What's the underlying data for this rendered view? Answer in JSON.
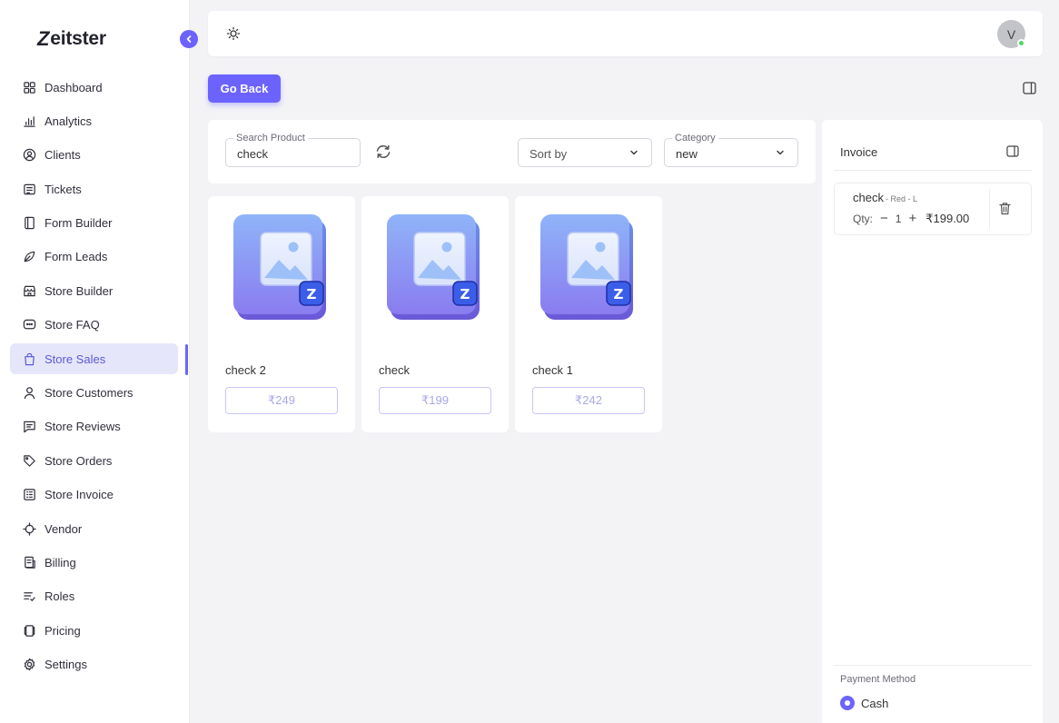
{
  "brand": {
    "name": "eitster",
    "mark": "Z"
  },
  "sidebar": {
    "items": [
      {
        "label": "Dashboard",
        "icon": "grid-icon"
      },
      {
        "label": "Analytics",
        "icon": "bar-chart-icon"
      },
      {
        "label": "Clients",
        "icon": "user-circle-icon"
      },
      {
        "label": "Tickets",
        "icon": "ticket-icon"
      },
      {
        "label": "Form Builder",
        "icon": "form-icon"
      },
      {
        "label": "Form Leads",
        "icon": "leaf-icon"
      },
      {
        "label": "Store Builder",
        "icon": "store-icon"
      },
      {
        "label": "Store FAQ",
        "icon": "chat-icon"
      },
      {
        "label": "Store Sales",
        "icon": "bag-icon"
      },
      {
        "label": "Store Customers",
        "icon": "user-icon"
      },
      {
        "label": "Store Reviews",
        "icon": "message-icon"
      },
      {
        "label": "Store Orders",
        "icon": "tag-icon"
      },
      {
        "label": "Store Invoice",
        "icon": "invoice-icon"
      },
      {
        "label": "Vendor",
        "icon": "vendor-icon"
      },
      {
        "label": "Billing",
        "icon": "billing-icon"
      },
      {
        "label": "Roles",
        "icon": "roles-icon"
      },
      {
        "label": "Pricing",
        "icon": "pricing-icon"
      },
      {
        "label": "Settings",
        "icon": "settings-icon"
      }
    ],
    "active": "Store Sales"
  },
  "topbar": {
    "avatar_initial": "V"
  },
  "actions": {
    "go_back": "Go Back"
  },
  "filters": {
    "search_label": "Search Product",
    "search_value": "check",
    "sort_placeholder": "Sort by",
    "category_label": "Category",
    "category_value": "new"
  },
  "products": [
    {
      "name": "check 2",
      "price": "₹249"
    },
    {
      "name": "check",
      "price": "₹199"
    },
    {
      "name": "check 1",
      "price": "₹242"
    }
  ],
  "invoice": {
    "title": "Invoice",
    "items": [
      {
        "name": "check",
        "variant": "- Red - L",
        "qty_label": "Qty:",
        "qty": "1",
        "price": "₹199.00"
      }
    ],
    "payment_label": "Payment Method",
    "payment_option": "Cash"
  },
  "colors": {
    "accent": "#6c63ff",
    "active_bg": "#e6e6fb",
    "online": "#4cd964"
  }
}
